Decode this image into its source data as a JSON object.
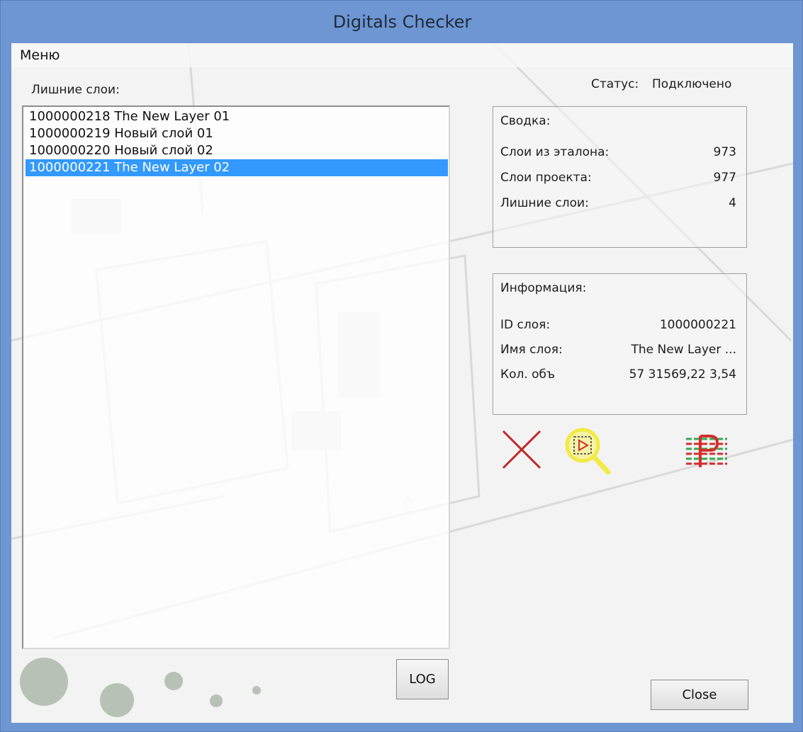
{
  "window": {
    "title": "Digitals Checker"
  },
  "menubar": {
    "menu_label": "Меню"
  },
  "status": {
    "label": "Статус:",
    "value": "Подключено"
  },
  "extra_layers": {
    "label": "Лишние слои:",
    "items": [
      "1000000218 The New Layer 01",
      "1000000219 Новый слой 01",
      "1000000220 Новый слой 02",
      "1000000221 The New Layer 02"
    ],
    "selected_index": 3
  },
  "summary": {
    "title": "Сводка:",
    "rows": [
      {
        "key": "Слои из эталона:",
        "value": "973"
      },
      {
        "key": "Слои проекта:",
        "value": "977"
      },
      {
        "key": "Лишние слои:",
        "value": "4"
      }
    ]
  },
  "info": {
    "title": "Информация:",
    "rows": [
      {
        "key": "ID слоя:",
        "value": "1000000221"
      },
      {
        "key": "Имя слоя:",
        "value": "The New Layer ..."
      },
      {
        "key": "Кол. объ",
        "value": "57 31569,22 3,54"
      }
    ]
  },
  "toolbar": {
    "delete_icon": "delete-x-icon",
    "zoom_icon": "zoom-to-layer-icon",
    "report_icon": "layer-report-icon"
  },
  "buttons": {
    "log_label": "LOG",
    "close_label": "Close"
  },
  "colors": {
    "selection": "#3399ff",
    "delete_icon": "#c0282b",
    "zoom_icon": "#f2ea45",
    "report_green": "#34a853",
    "report_red": "#d62d2d"
  }
}
